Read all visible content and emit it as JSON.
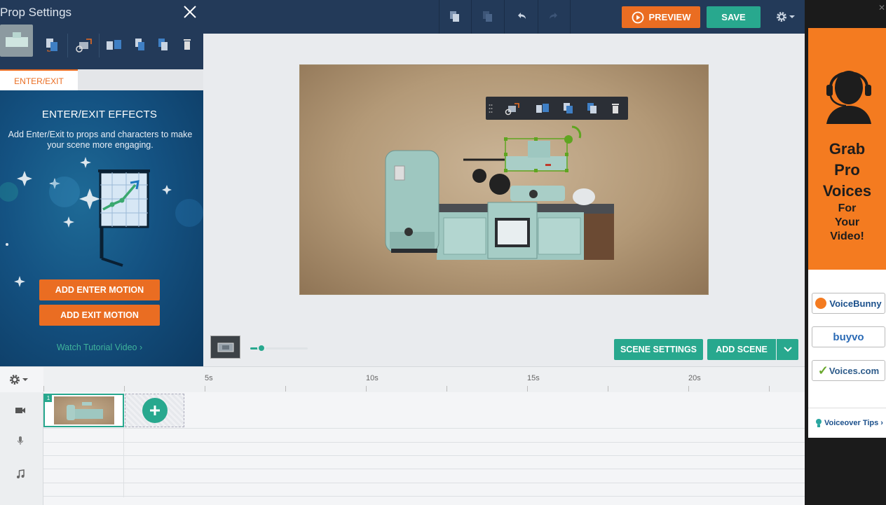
{
  "toolbar": {
    "preview_label": "PREVIEW",
    "save_label": "SAVE"
  },
  "panel": {
    "title": "Prop Settings",
    "tab_label": "ENTER/EXIT",
    "effects_title": "ENTER/EXIT EFFECTS",
    "effects_desc": "Add Enter/Exit to props and characters to make your scene more engaging.",
    "add_enter": "ADD ENTER MOTION",
    "add_exit": "ADD EXIT MOTION",
    "tutorial": "Watch Tutorial Video",
    "tutorial_chevron": "›"
  },
  "scene": {
    "settings_label": "SCENE SETTINGS",
    "add_label": "ADD SCENE",
    "zoom_level": 0.2
  },
  "timeline": {
    "ticks": [
      "5s",
      "10s",
      "15s",
      "20s"
    ],
    "clip_number": "1"
  },
  "ad": {
    "lines": [
      "Grab",
      "Pro",
      "Voices",
      "For",
      "Your",
      "Video!"
    ],
    "logos": [
      "VoiceBunny",
      "buyvo",
      "Voices.com"
    ],
    "tips": "Voiceover Tips",
    "tips_chevron": "›",
    "close": "✕"
  },
  "colors": {
    "accent_orange": "#ea6d22",
    "accent_green": "#28a88e",
    "nav_dark": "#233a59",
    "panel_blue": "#0d3a62"
  }
}
